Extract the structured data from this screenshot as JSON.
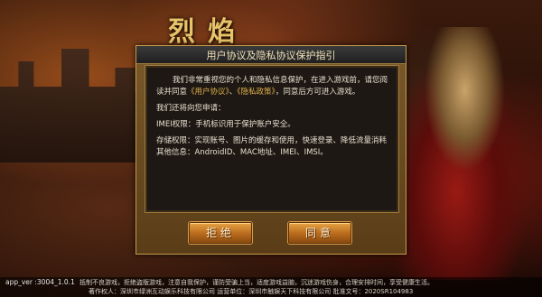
{
  "logo": {
    "text": "烈焰"
  },
  "dialog": {
    "title": "用户协议及隐私协议保护指引",
    "intro_before": "我们非常重视您的个人和隐私信息保护，在进入游戏前，请您阅读并同意",
    "user_agreement_link": "《用户协议》",
    "separator": "、",
    "privacy_policy_link": "《隐私政策》",
    "intro_after": "，同意后方可进入游戏。",
    "permissions_heading": "我们还将向您申请：",
    "imei_permission": "IMEI权限：手机标识用于保护账户安全。",
    "storage_permission": "存储权限：实现账号、图片的缓存和使用，快速登录、降低流量消耗其他信息：AndroidID、MAC地址、IMEI、IMSI。",
    "reject_label": "拒绝",
    "agree_label": "同意"
  },
  "footer": {
    "app_ver": "app_ver   :3004_1.0.1",
    "notice": "抵制不良游戏，拒绝盗版游戏，注意自我保护，谨防受骗上当，适度游戏益脑，沉迷游戏伤身，合理安排时间，享受健康生活。",
    "copyright": "著作权人：深圳市绿洲互动娱乐科技有限公司  运营单位：深圳市触娱天下科技有限公司  批准文号：2020SR104983"
  }
}
